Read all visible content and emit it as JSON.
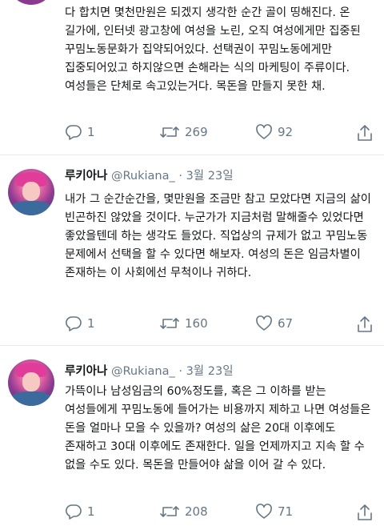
{
  "tweets": [
    {
      "text": "다 합치면 몇천만원은 되겠지 생각한 순간 골이 띵해진다. 온 길가에, 인터넷 광고창에 여성을 노린, 오직 여성에게만 집중된 꾸밈노동문화가 집약되어있다. 선택권이 꾸밈노동에게만 집중되어있고 하지않으면 손해라는 식의 마케팅이 주류이다. 여성들은 단체로 속고있는거다. 목돈을 만들지 못한 채.",
      "replies": "1",
      "retweets": "269",
      "likes": "92"
    },
    {
      "name": "루키아나",
      "handle": "@Rukiana_",
      "date": "3월 23일",
      "text": "내가 그 순간순간을, 몇만원을 조금만 참고 모았다면 지금의 삶이 빈곤하진 않았을 것이다. 누군가가 지금처럼 말해줄수 있었다면 좋았을텐데 하는 생각도 들었다. 직업상의 규제가 없고 꾸밈노동 문제에서 선택을 할 수 있다면 해보자. 여성의 돈은 임금차별이 존재하는 이 사회에선 무척이나 귀하다.",
      "replies": "1",
      "retweets": "160",
      "likes": "67"
    },
    {
      "name": "루키아나",
      "handle": "@Rukiana_",
      "date": "3월 23일",
      "text": "가뜩이나 남성임금의 60%정도를, 혹은 그 이하를 받는 여성들에게 꾸밈노동에 들어가는 비용까지 제하고 나면 여성들은 돈을 얼마나 모을 수 있을까? 여성의 삶은 20대 이후에도 존재하고 30대 이후에도 존재한다. 일을 언제까지고 지속 할 수 없을 수도 있다. 목돈을 만들어야 삶을 이어 갈 수 있다.",
      "replies": "1",
      "retweets": "208",
      "likes": "71"
    }
  ],
  "colors": {
    "text": "#14171a",
    "secondary": "#657786",
    "divider": "#e6ecf0"
  }
}
